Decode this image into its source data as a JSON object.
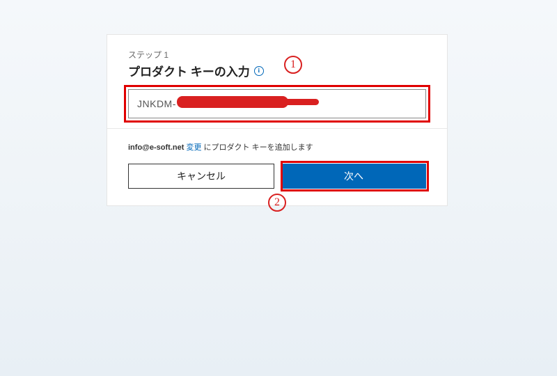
{
  "step_label": "ステップ 1",
  "title": "プロダクト キーの入力",
  "product_key_value": "JNKDM-",
  "account_email": "info@e-soft.net",
  "change_link": "変更",
  "account_suffix": "にプロダクト キーを追加します",
  "buttons": {
    "cancel": "キャンセル",
    "next": "次へ"
  },
  "annotations": {
    "one": "1",
    "two": "2"
  }
}
